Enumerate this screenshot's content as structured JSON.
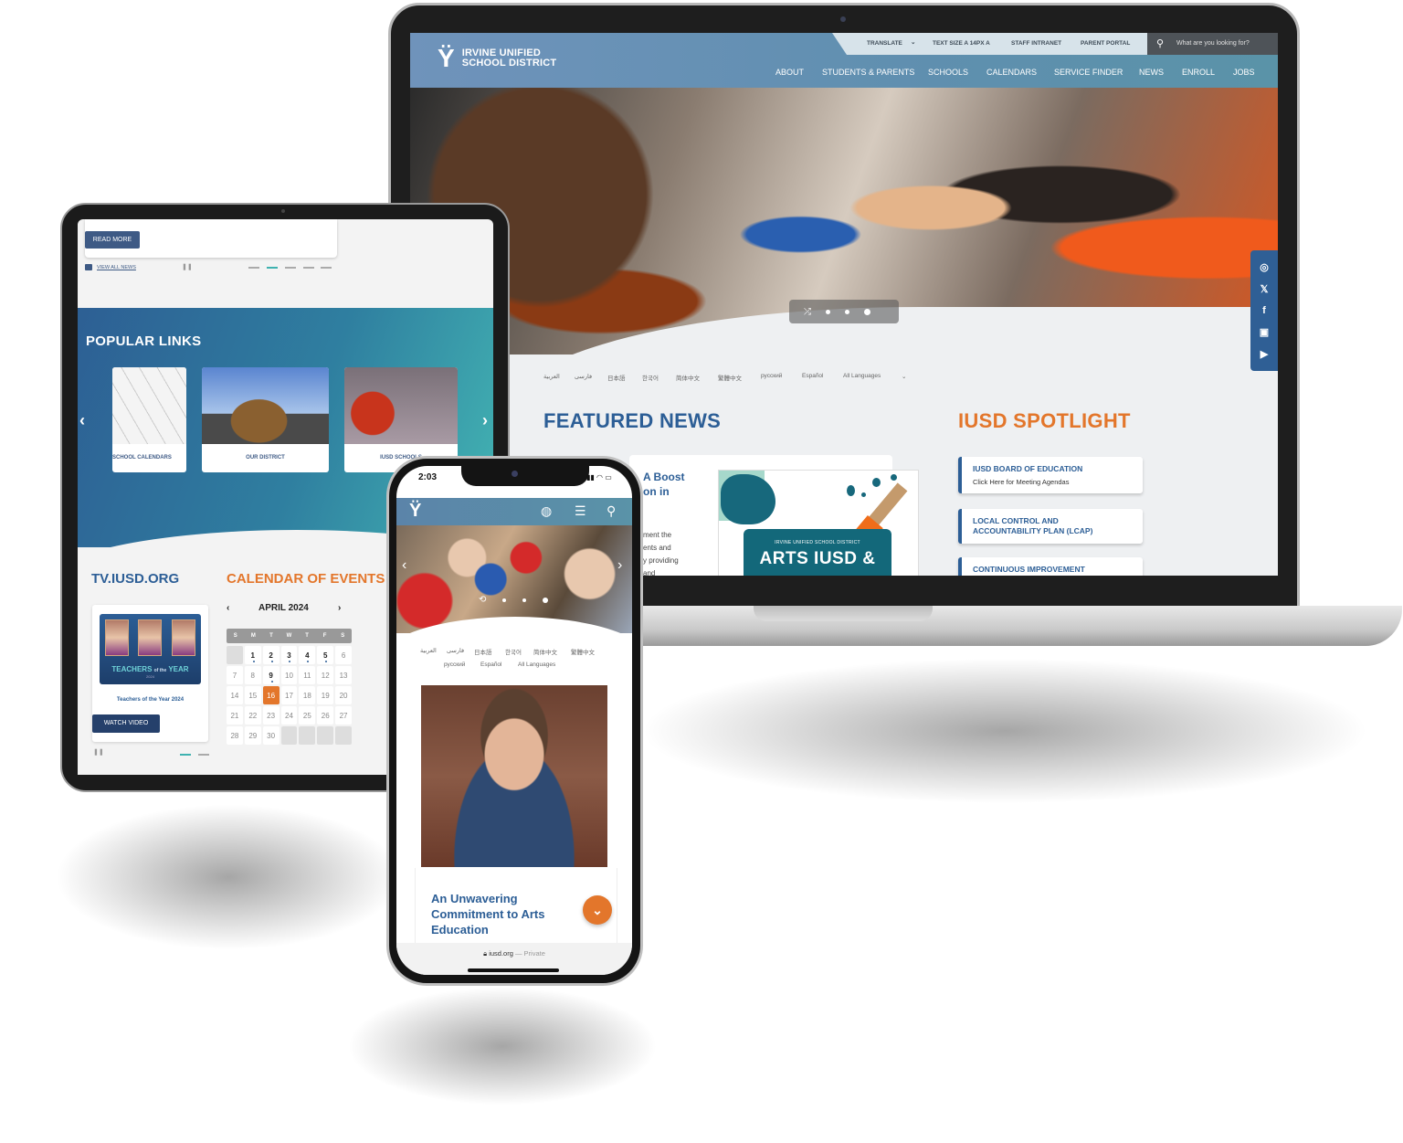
{
  "laptop": {
    "site_name_line1": "IRVINE UNIFIED",
    "site_name_line2": "SCHOOL DISTRICT",
    "utility": {
      "translate": "TRANSLATE",
      "translate_chevron": "⌄",
      "text_size": "TEXT SIZE A 14PX A",
      "staff_intranet": "STAFF INTRANET",
      "parent_portal": "PARENT PORTAL"
    },
    "search": {
      "icon": "search-icon",
      "placeholder": "What are you looking for?"
    },
    "nav": [
      "ABOUT",
      "STUDENTS & PARENTS",
      "SCHOOLS",
      "CALENDARS",
      "SERVICE FINDER",
      "NEWS",
      "ENROLL",
      "JOBS"
    ],
    "hero": {
      "slides": 3,
      "active_slide": 3
    },
    "social": [
      "instagram-icon",
      "x-icon",
      "facebook-icon",
      "parentsquare-icon",
      "youtube-icon"
    ],
    "languages": [
      "العربية",
      "فارسی",
      "日本語",
      "한국어",
      "简体中文",
      "繁體中文",
      "русский",
      "Español",
      "All Languages"
    ],
    "featured_news": {
      "title": "FEATURED NEWS",
      "headline_partial": "A Boost\non in",
      "body_partial": "ment the\nents and\ny providing\nand",
      "image": {
        "org": "IRVINE UNIFIED SCHOOL DISTRICT",
        "title": "ARTS IUSD &"
      }
    },
    "spotlight": {
      "title": "IUSD SPOTLIGHT",
      "items": [
        {
          "title": "IUSD BOARD OF EDUCATION",
          "subtitle": "Click Here for Meeting Agendas"
        },
        {
          "title": "LOCAL CONTROL AND ACCOUNTABILITY PLAN (LCAP)",
          "subtitle": ""
        },
        {
          "title": "CONTINUOUS IMPROVEMENT",
          "subtitle": ""
        }
      ]
    }
  },
  "tablet": {
    "read_more": "READ MORE",
    "view_all_news": "VIEW ALL NEWS",
    "news_pager": {
      "count": 5,
      "active": 2
    },
    "popular_links": {
      "title": "POPULAR LINKS",
      "items": [
        "SCHOOL CALENDARS",
        "OUR DISTRICT",
        "IUSD SCHOOLS"
      ]
    },
    "tv": {
      "title": "TV.IUSD.ORG",
      "video_caption": "Teachers of the Year 2024",
      "thumb_title_a": "TEACHERS",
      "thumb_title_b": "of the",
      "thumb_title_c": "YEAR",
      "thumb_year": "2024",
      "watch_video": "WATCH VIDEO",
      "pager": {
        "count": 2,
        "active": 1
      }
    },
    "calendar": {
      "title": "CALENDAR OF EVENTS",
      "month": "APRIL 2024",
      "weekdays": [
        "S",
        "M",
        "T",
        "W",
        "T",
        "F",
        "S"
      ],
      "first_weekday_offset": 1,
      "days_in_month": 30,
      "event_days": [
        1,
        2,
        3,
        4,
        5,
        9
      ],
      "today": 16
    }
  },
  "phone": {
    "time": "2:03",
    "languages_row1": [
      "العربية",
      "فارسی",
      "日本語",
      "한국어",
      "简体中文",
      "繁體中文"
    ],
    "languages_row2": [
      "русский",
      "Español",
      "All Languages"
    ],
    "article_title": "An Unwavering Commitment to Arts Education",
    "url": "iusd.org",
    "url_suffix": "— Private"
  },
  "colors": {
    "brand_blue": "#2c5e96",
    "accent_orange": "#e3762b",
    "header_teal": "#5a93a8"
  }
}
